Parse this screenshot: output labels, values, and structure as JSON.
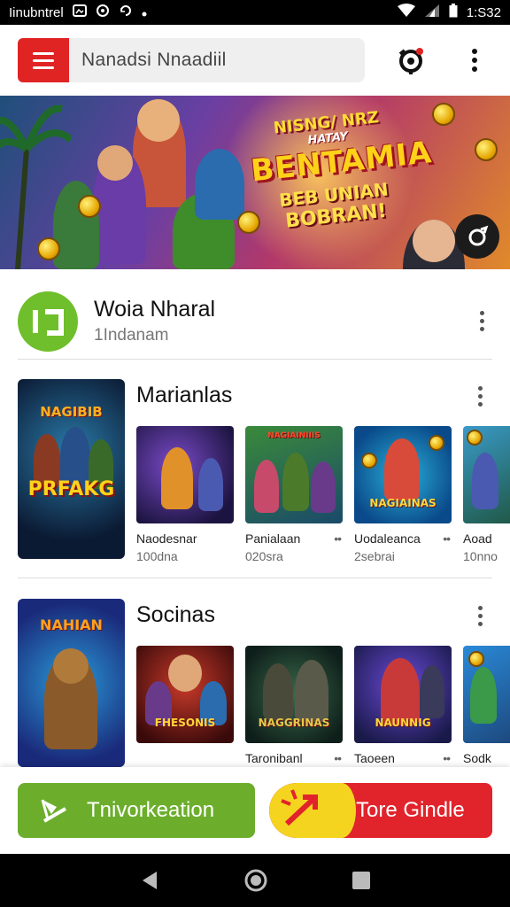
{
  "status_bar": {
    "left_text": "Iinubntrel",
    "time": "1:S32",
    "icons": [
      "image-icon",
      "sync-icon",
      "sync-icon",
      "dot-icon",
      "wifi-icon",
      "signal-icon",
      "battery-icon"
    ]
  },
  "top_bar": {
    "search_text": "Nanadsi Nnaadiil",
    "icons": [
      "menu-icon",
      "profile-icon",
      "more-vert-icon"
    ],
    "accent": "#e02424"
  },
  "banner": {
    "line1": "NISNG/ NRZ",
    "line2": "HATAY",
    "line3": "BENTAMIA",
    "line4": "BEB UNIAN",
    "line5": "BOBRAN!"
  },
  "developer": {
    "name": "Woia Nharal",
    "subtitle": "1Indanam"
  },
  "sections": [
    {
      "title": "Marianlas",
      "feature_text_top": "NAGIBIB",
      "feature_text_bottom": "PRFAKG",
      "tiles": [
        {
          "name": "Naodesnar",
          "size": "100dna",
          "thumb_text": ""
        },
        {
          "name": "Panialaan",
          "size": "020sra",
          "thumb_text": ""
        },
        {
          "name": "Uodaleanca",
          "size": "2sebrai",
          "thumb_text": "NAGIAINAS"
        },
        {
          "name": "Aoad",
          "size": "10nno",
          "thumb_text": ""
        }
      ]
    },
    {
      "title": "Socinas",
      "feature_text_top": "NAHIAN",
      "feature_text_bottom": "",
      "tiles": [
        {
          "name": "",
          "size": "",
          "thumb_text": "FHESONIS"
        },
        {
          "name": "Taronibanl",
          "size": "",
          "thumb_text": "NAGGRINAS"
        },
        {
          "name": "Taoeen",
          "size": "",
          "thumb_text": "NAUNNIG"
        },
        {
          "name": "Sodk",
          "size": "",
          "thumb_text": ""
        }
      ]
    }
  ],
  "actions": {
    "primary_label": "Tnivorkeation",
    "secondary_label": "Tore Gindle",
    "primary_color": "#6cae2c",
    "secondary_color": "#e1232b"
  },
  "nav": {
    "icons": [
      "back-icon",
      "home-icon",
      "recents-icon"
    ]
  }
}
